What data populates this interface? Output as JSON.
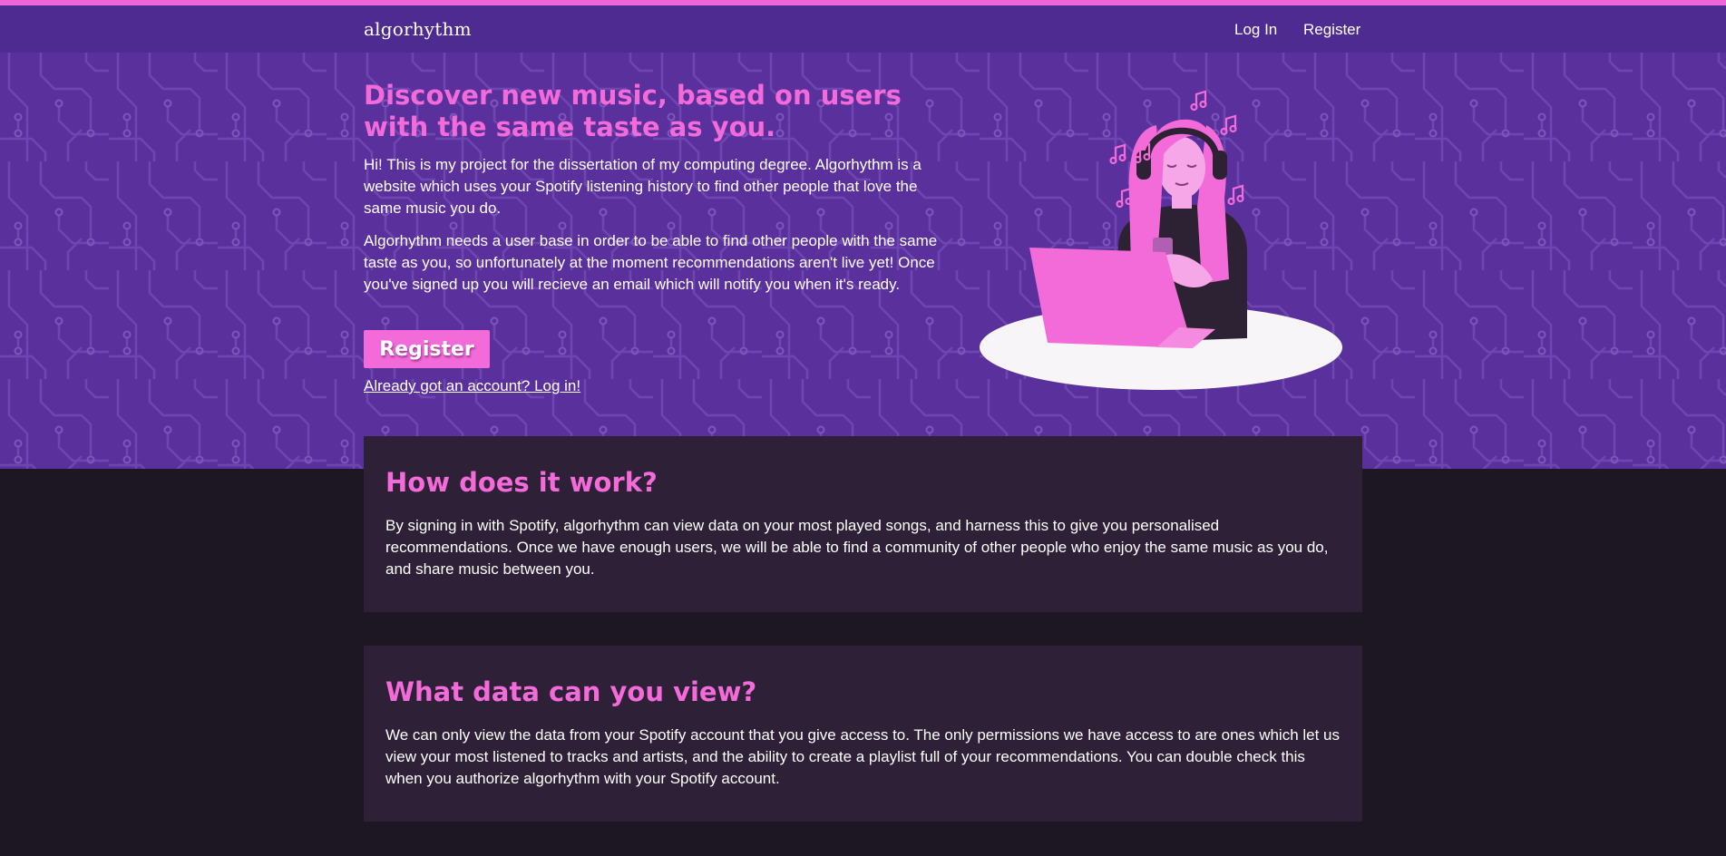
{
  "header": {
    "brand": "algorhythm",
    "nav": {
      "login_label": "Log In",
      "register_label": "Register"
    }
  },
  "hero": {
    "title": "Discover new music, based on users with the same taste as you.",
    "paragraph_1": "Hi! This is my project for the dissertation of my computing degree. Algorhythm is a website which uses your Spotify listening history to find other people that love the same music you do.",
    "paragraph_2": "Algorhythm needs a user base in order to be able to find other people with the same taste as you, so unfortunately at the moment recommendations aren't live yet! Once you've signed up you will recieve an email which will notify you when it's ready.",
    "register_button_label": "Register",
    "login_link_label": "Already got an account? Log in!",
    "illustration_icon": "woman-with-headphones-laptop-illustration"
  },
  "sections": [
    {
      "heading": "How does it work?",
      "body": "By signing in with Spotify, algorhythm can view data on your most played songs, and harness this to give you personalised recommendations. Once we have enough users, we will be able to find a community of other people who enjoy the same music as you do, and share music between you."
    },
    {
      "heading": "What data can you view?",
      "body": "We can only view the data from your Spotify account that you give access to. The only permissions we have access to are ones which let us view your most listened to tracks and artists, and the ability to create a playlist full of your recommendations. You can double check this when you authorize algorhythm with your Spotify account."
    }
  ],
  "colors": {
    "accent_pink": "#f36ad9",
    "nav_purple": "#4e2b91",
    "hero_purple": "#5a309d",
    "page_background": "#1d1724",
    "card_background": "#2d2037"
  }
}
